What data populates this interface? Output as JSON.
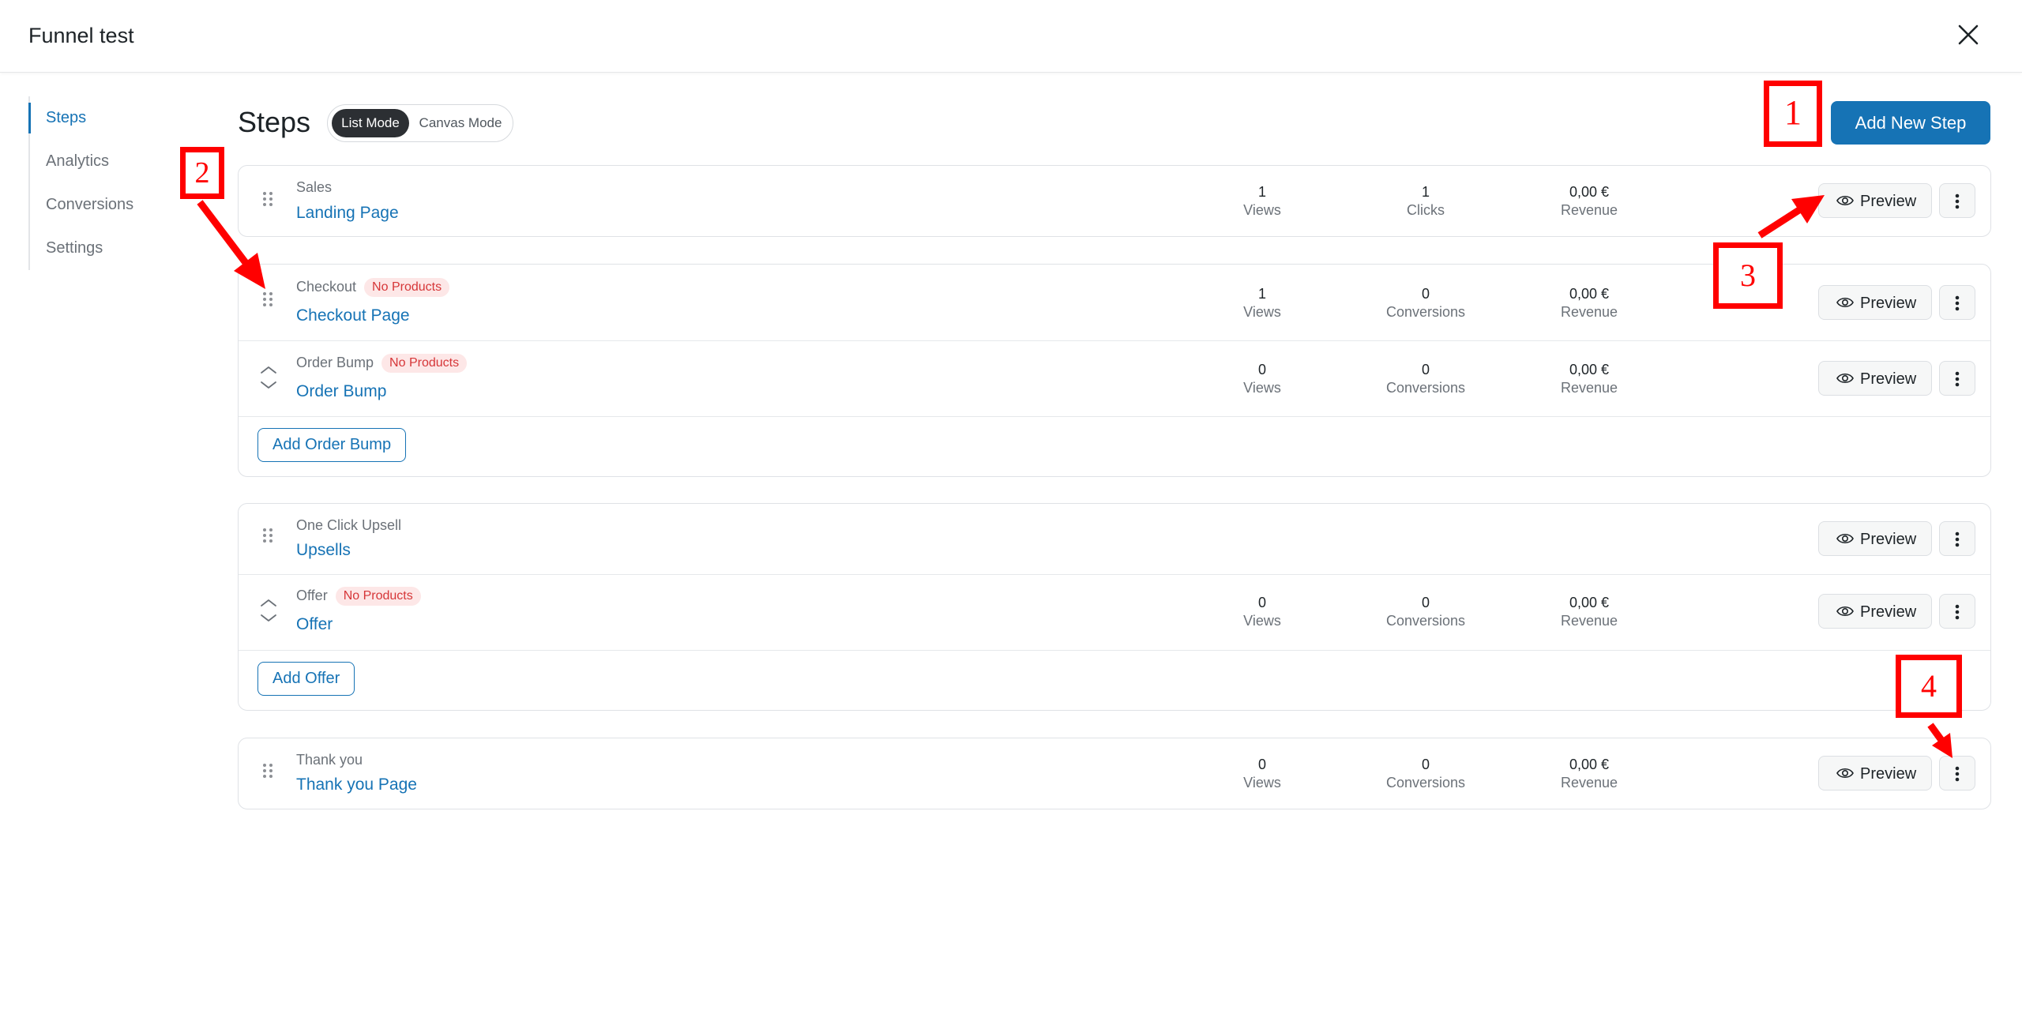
{
  "header": {
    "title": "Funnel test"
  },
  "sidebar": {
    "items": [
      {
        "label": "Steps",
        "active": true
      },
      {
        "label": "Analytics",
        "active": false
      },
      {
        "label": "Conversions",
        "active": false
      },
      {
        "label": "Settings",
        "active": false
      }
    ]
  },
  "main": {
    "title": "Steps",
    "modes": {
      "list": "List Mode",
      "canvas": "Canvas Mode",
      "selected": "List Mode"
    },
    "add_step_label": "Add New Step",
    "preview_label": "Preview",
    "add_order_bump_label": "Add Order Bump",
    "add_offer_label": "Add Offer",
    "steps": {
      "sales": {
        "type": "Sales",
        "name": "Landing Page",
        "views": "1",
        "views_label": "Views",
        "second": "1",
        "second_label": "Clicks",
        "revenue": "0,00 €",
        "revenue_label": "Revenue"
      },
      "checkout": {
        "type": "Checkout",
        "badge": "No Products",
        "name": "Checkout Page",
        "views": "1",
        "views_label": "Views",
        "second": "0",
        "second_label": "Conversions",
        "revenue": "0,00 €",
        "revenue_label": "Revenue"
      },
      "order_bump": {
        "type": "Order Bump",
        "badge": "No Products",
        "name": "Order Bump",
        "views": "0",
        "views_label": "Views",
        "second": "0",
        "second_label": "Conversions",
        "revenue": "0,00 €",
        "revenue_label": "Revenue"
      },
      "upsell": {
        "type": "One Click Upsell",
        "name": "Upsells"
      },
      "offer": {
        "type": "Offer",
        "badge": "No Products",
        "name": "Offer",
        "views": "0",
        "views_label": "Views",
        "second": "0",
        "second_label": "Conversions",
        "revenue": "0,00 €",
        "revenue_label": "Revenue"
      },
      "thankyou": {
        "type": "Thank you",
        "name": "Thank you Page",
        "views": "0",
        "views_label": "Views",
        "second": "0",
        "second_label": "Conversions",
        "revenue": "0,00 €",
        "revenue_label": "Revenue"
      }
    }
  },
  "annotations": {
    "n1": "1",
    "n2": "2",
    "n3": "3",
    "n4": "4",
    "color": "#ff0000"
  },
  "colors": {
    "accent": "#1673b5",
    "badge_text": "#d63638",
    "badge_bg": "#fde7e7",
    "toggle_active": "#2c2f33"
  }
}
